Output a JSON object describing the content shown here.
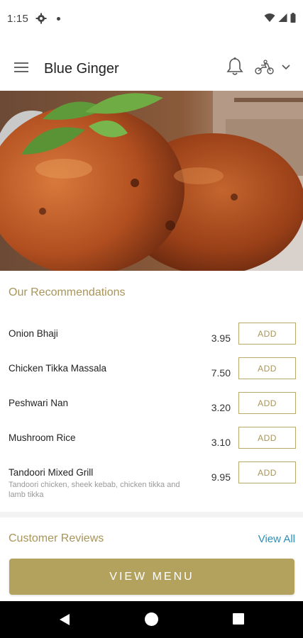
{
  "status_bar": {
    "time": "1:15",
    "icons": [
      "gear-icon",
      "notification-dot",
      "wifi-icon",
      "signal-icon",
      "battery-icon"
    ]
  },
  "app_bar": {
    "title": "Blue Ginger",
    "icons": [
      "menu-icon",
      "bell-icon",
      "delivery-rider-icon",
      "chevron-down-icon"
    ]
  },
  "hero": {
    "image": "tandoori-chicken-photo"
  },
  "recommendations": {
    "title": "Our Recommendations",
    "items": [
      {
        "name": "Onion Bhaji",
        "description": "",
        "price": "3.95",
        "button": "ADD"
      },
      {
        "name": "Chicken Tikka Massala",
        "description": "",
        "price": "7.50",
        "button": "ADD"
      },
      {
        "name": "Peshwari Nan",
        "description": "",
        "price": "3.20",
        "button": "ADD"
      },
      {
        "name": "Mushroom Rice",
        "description": "",
        "price": "3.10",
        "button": "ADD"
      },
      {
        "name": "Tandoori Mixed Grill",
        "description": "Tandoori chicken, sheek kebab, chicken tikka and lamb tikka",
        "price": "9.95",
        "button": "ADD"
      }
    ]
  },
  "reviews": {
    "title": "Customer Reviews",
    "view_all": "View All"
  },
  "footer": {
    "view_menu": "VIEW MENU"
  },
  "colors": {
    "accent_gold": "#b3a25d",
    "link_blue": "#2a8fb8",
    "nav_bar": "#000000"
  }
}
